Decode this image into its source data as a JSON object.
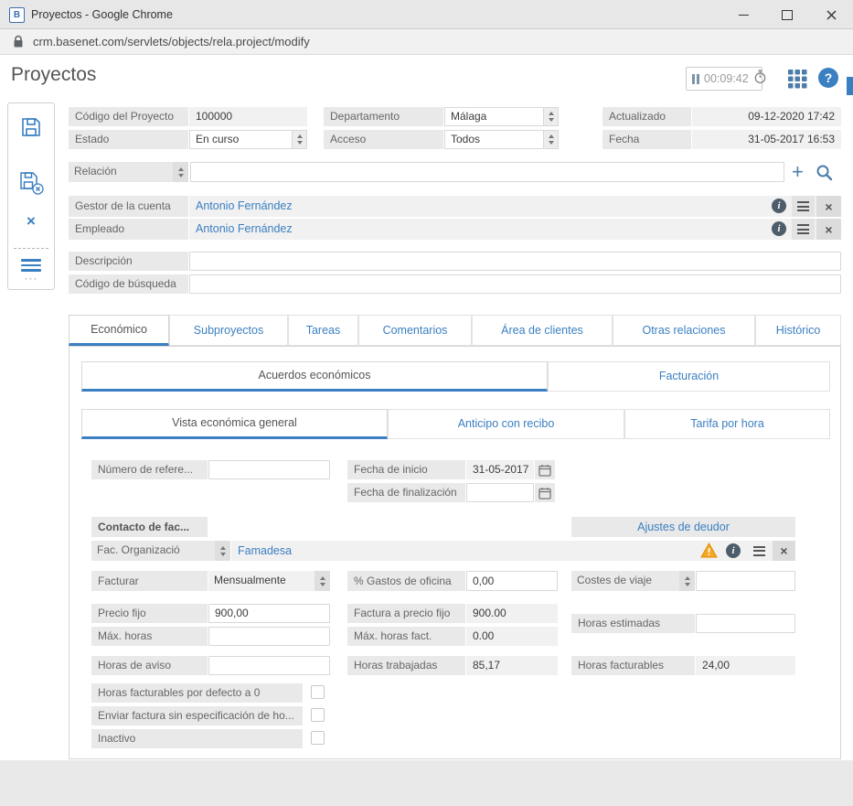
{
  "window": {
    "title": "Proyectos - Google Chrome",
    "url": "crm.basenet.com/servlets/objects/rela.project/modify"
  },
  "header": {
    "title": "Proyectos",
    "timer": "00:09:42"
  },
  "icons": {
    "logo": "B",
    "help": "?",
    "plus": "+",
    "close": "×",
    "info": "i",
    "more": "···"
  },
  "accent": "#3a7fc1",
  "fields": {
    "codigo": {
      "label": "Código del Proyecto",
      "value": "100000"
    },
    "estado": {
      "label": "Estado",
      "value": "En curso"
    },
    "departamento": {
      "label": "Departamento",
      "value": "Málaga"
    },
    "acceso": {
      "label": "Acceso",
      "value": "Todos"
    },
    "actualizado": {
      "label": "Actualizado",
      "value": "09-12-2020 17:42"
    },
    "fecha": {
      "label": "Fecha",
      "value": "31-05-2017 16:53"
    },
    "relacion": {
      "label": "Relación",
      "value": ""
    },
    "gestor": {
      "label": "Gestor de la cuenta",
      "value": "Antonio Fernández"
    },
    "empleado": {
      "label": "Empleado",
      "value": "Antonio Fernández"
    },
    "descripcion": {
      "label": "Descripción",
      "value": ""
    },
    "busqueda": {
      "label": "Código de búsqueda",
      "value": ""
    }
  },
  "tabs": {
    "main": [
      {
        "label": "Económico",
        "active": true
      },
      {
        "label": "Subproyectos",
        "active": false
      },
      {
        "label": "Tareas",
        "active": false
      },
      {
        "label": "Comentarios",
        "active": false
      },
      {
        "label": "Área de clientes",
        "active": false
      },
      {
        "label": "Otras relaciones",
        "active": false
      },
      {
        "label": "Histórico",
        "active": false
      }
    ],
    "sub": [
      {
        "label": "Acuerdos económicos",
        "active": true
      },
      {
        "label": "Facturación",
        "active": false
      }
    ],
    "view": [
      {
        "label": "Vista económica general",
        "active": true
      },
      {
        "label": "Anticipo con recibo",
        "active": false
      },
      {
        "label": "Tarifa por hora",
        "active": false
      }
    ]
  },
  "eco": {
    "numero_ref": {
      "label": "Número de refere...",
      "value": ""
    },
    "fecha_inicio": {
      "label": "Fecha de inicio",
      "value": "31-05-2017"
    },
    "fecha_fin": {
      "label": "Fecha de finalización",
      "value": ""
    },
    "contacto": {
      "label": "Contacto de fac..."
    },
    "ajustes": {
      "label": "Ajustes de deudor"
    },
    "fac_org": {
      "label": "Fac. Organizació",
      "value": "Famadesa"
    },
    "facturar": {
      "label": "Facturar",
      "value": "Mensualmente"
    },
    "gastos": {
      "label": "% Gastos de oficina",
      "value": "0,00"
    },
    "costes": {
      "label": "Costes de viaje",
      "value": ""
    },
    "precio_fijo": {
      "label": "Precio fijo",
      "value": "900,00"
    },
    "factura_fijo": {
      "label": "Factura a precio fijo",
      "value": "900.00"
    },
    "horas_estimadas": {
      "label": "Horas estimadas",
      "value": ""
    },
    "max_horas": {
      "label": "Máx. horas",
      "value": ""
    },
    "max_horas_fact": {
      "label": "Máx. horas fact.",
      "value": "0.00"
    },
    "horas_aviso": {
      "label": "Horas de aviso",
      "value": ""
    },
    "horas_trabajadas": {
      "label": "Horas trabajadas",
      "value": "85,17"
    },
    "horas_facturables": {
      "label": "Horas facturables",
      "value": "24,00"
    },
    "checks": [
      {
        "label": "Horas facturables por defecto a 0",
        "checked": false
      },
      {
        "label": "Enviar factura sin especificación de ho...",
        "checked": false
      },
      {
        "label": "Inactivo",
        "checked": false
      }
    ]
  }
}
